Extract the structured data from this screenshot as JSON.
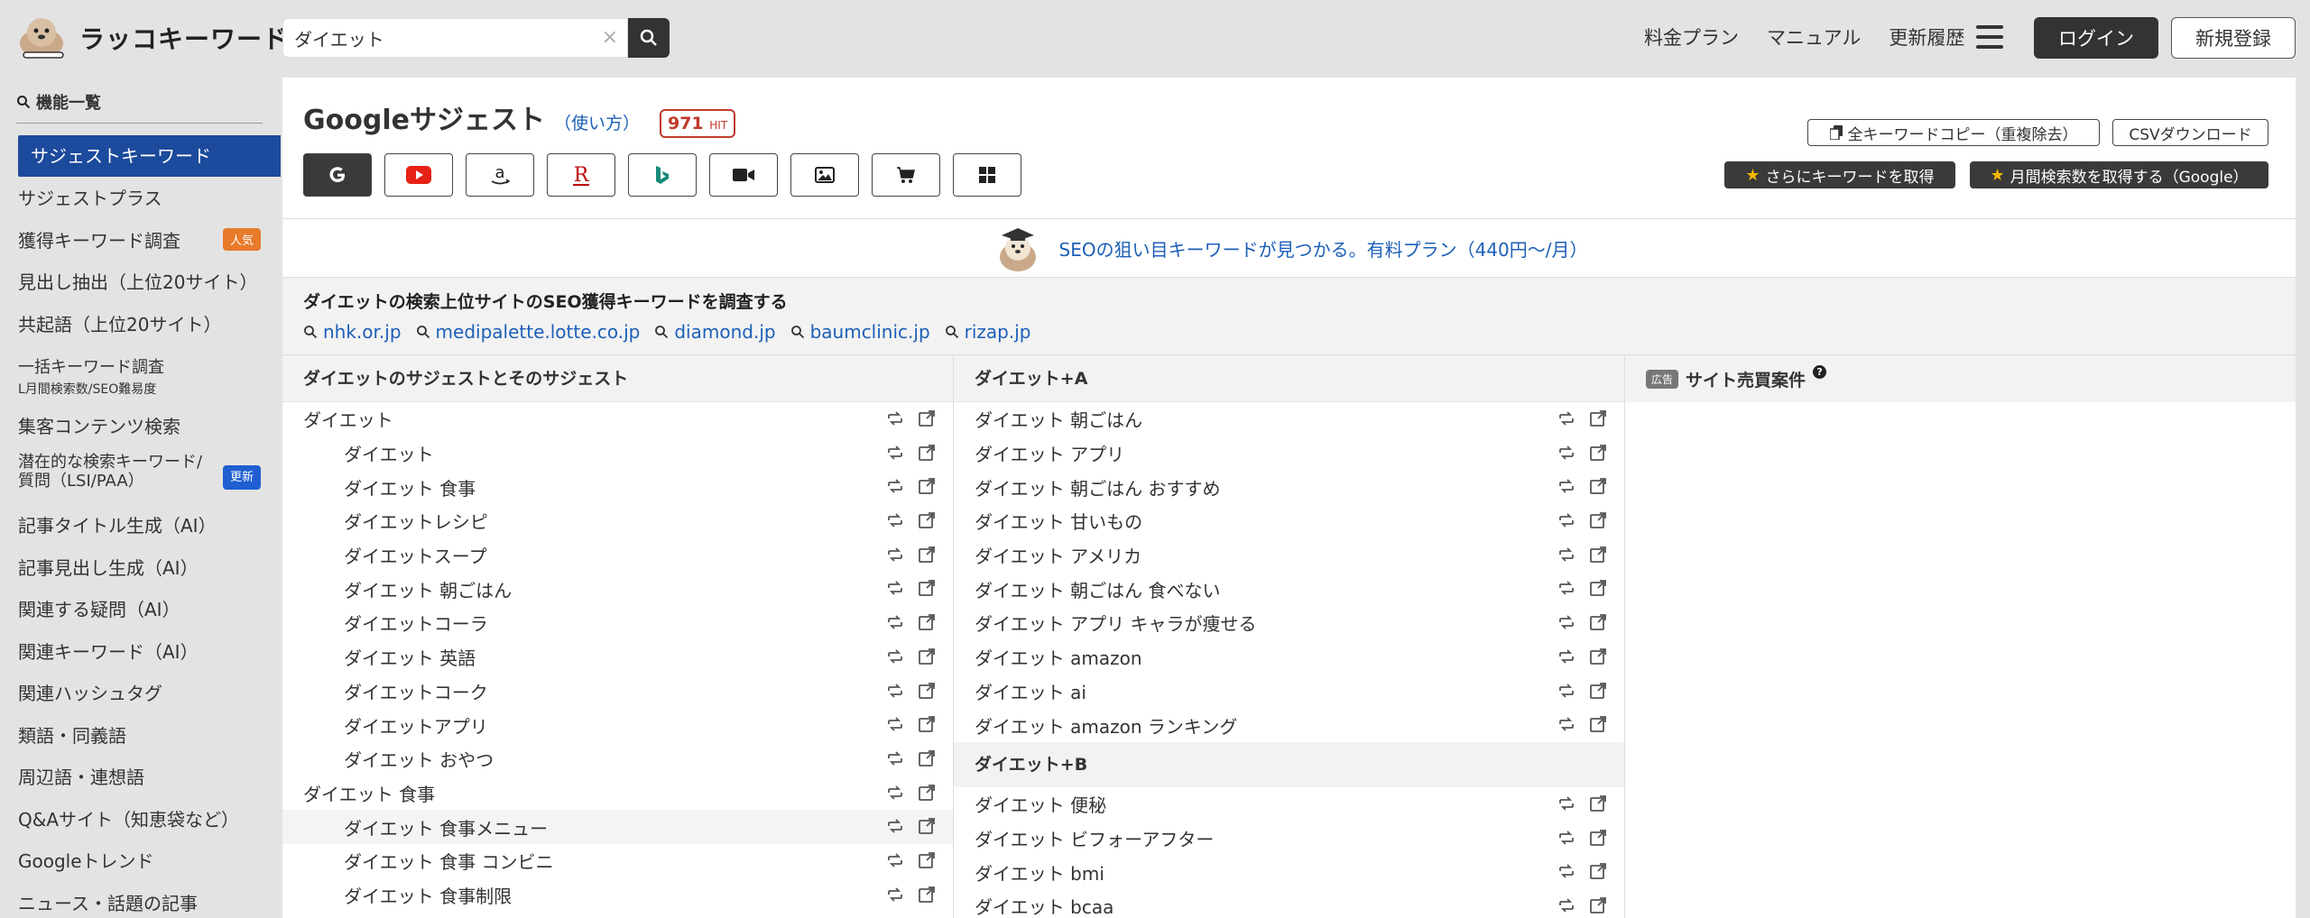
{
  "header": {
    "logo_text": "ラッコキーワード",
    "search_value": "ダイエット",
    "nav": [
      "料金プラン",
      "マニュアル",
      "更新履歴"
    ],
    "login_label": "ログイン",
    "signup_label": "新規登録"
  },
  "sidebar": {
    "heading": "機能一覧",
    "items": [
      {
        "label": "サジェストキーワード"
      },
      {
        "label": "サジェストプラス"
      },
      {
        "label": "獲得キーワード調査",
        "badge": "人気"
      },
      {
        "label": "見出し抽出（上位20サイト）"
      },
      {
        "label": "共起語（上位20サイト）"
      },
      {
        "label": "一括キーワード調査",
        "sub": "L月間検索数/SEO難易度"
      },
      {
        "label": "集客コンテンツ検索"
      },
      {
        "label": "潜在的な検索キーワード/",
        "label2": "質問（LSI/PAA）",
        "badge": "更新"
      },
      {
        "label": "記事タイトル生成（AI）"
      },
      {
        "label": "記事見出し生成（AI）"
      },
      {
        "label": "関連する疑問（AI）"
      },
      {
        "label": "関連キーワード（AI）"
      },
      {
        "label": "関連ハッシュタグ"
      },
      {
        "label": "類語・同義語"
      },
      {
        "label": "周辺語・連想語"
      },
      {
        "label": "Q&Aサイト（知恵袋など）"
      },
      {
        "label": "Googleトレンド"
      },
      {
        "label": "ニュース・話題の記事"
      }
    ]
  },
  "main": {
    "title": "Googleサジェスト",
    "howto": "（使い方）",
    "hit_count": "971",
    "hit_unit": "HIT",
    "copy_all_label": "全キーワードコピー（重複除去）",
    "csv_label": "CSVダウンロード",
    "more_label": "さらにキーワードを取得",
    "monthly_label": "月間検索数を取得する（Google）",
    "promo_text": "SEOの狙い目キーワードが見つかる。有料プラン（440円〜/月）",
    "research_title": "ダイエットの検索上位サイトのSEO獲得キーワードを調査する",
    "sites": [
      "nhk.or.jp",
      "medipalette.lotte.co.jp",
      "diamond.jp",
      "baumclinic.jp",
      "rizap.jp"
    ]
  },
  "columns": {
    "col1_head": "ダイエットのサジェストとそのサジェスト",
    "col1_rows": [
      {
        "text": "ダイエット",
        "level": "parent"
      },
      {
        "text": "ダイエット",
        "level": "child"
      },
      {
        "text": "ダイエット 食事",
        "level": "child"
      },
      {
        "text": "ダイエットレシピ",
        "level": "child"
      },
      {
        "text": "ダイエットスープ",
        "level": "child"
      },
      {
        "text": "ダイエット 朝ごはん",
        "level": "child"
      },
      {
        "text": "ダイエットコーラ",
        "level": "child"
      },
      {
        "text": "ダイエット 英語",
        "level": "child"
      },
      {
        "text": "ダイエットコーク",
        "level": "child"
      },
      {
        "text": "ダイエットアプリ",
        "level": "child"
      },
      {
        "text": "ダイエット おやつ",
        "level": "child"
      },
      {
        "text": "ダイエット 食事",
        "level": "parent"
      },
      {
        "text": "ダイエット 食事メニュー",
        "level": "child",
        "hover": true
      },
      {
        "text": "ダイエット 食事 コンビニ",
        "level": "child"
      },
      {
        "text": "ダイエット 食事制限",
        "level": "child"
      }
    ],
    "col2_head_a": "ダイエット+A",
    "col2_rows_a": [
      "ダイエット 朝ごはん",
      "ダイエット アプリ",
      "ダイエット 朝ごはん おすすめ",
      "ダイエット 甘いもの",
      "ダイエット アメリカ",
      "ダイエット 朝ごはん 食べない",
      "ダイエット アプリ キャラが痩せる",
      "ダイエット amazon",
      "ダイエット ai",
      "ダイエット amazon ランキング"
    ],
    "col2_head_b": "ダイエット+B",
    "col2_rows_b": [
      "ダイエット 便秘",
      "ダイエット ビフォーアフター",
      "ダイエット bmi",
      "ダイエット bcaa"
    ],
    "col3_ad_tag": "広告",
    "col3_head": "サイト売買案件"
  },
  "icons": [
    "search-icon",
    "close-icon",
    "menu-icon",
    "google-icon",
    "youtube-icon",
    "amazon-icon",
    "rakuten-icon",
    "bing-icon",
    "video-icon",
    "image-icon",
    "cart-icon",
    "apps-icon",
    "copy-icon",
    "star-icon",
    "refresh-icon",
    "external-link-icon",
    "help-icon"
  ],
  "colors": {
    "accent": "#1c4a9c",
    "link": "#1c5fb8",
    "hit": "#c0392b",
    "popular": "#e87a2b",
    "new": "#1f5fd1",
    "dark_button": "#3a3a3a"
  }
}
